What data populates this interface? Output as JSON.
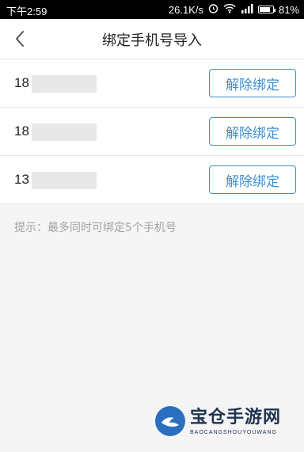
{
  "status_bar": {
    "time": "下午2:59",
    "speed": "26.1K/s",
    "battery_text": "81%",
    "battery_level": 0.81,
    "icons": [
      "alarm-icon",
      "wifi-icon",
      "signal-icon",
      "battery-icon"
    ]
  },
  "header": {
    "title": "绑定手机号导入",
    "back_icon": "chevron-left-icon"
  },
  "bound_numbers": [
    {
      "visible_prefix": "18",
      "unbind_label": "解除绑定"
    },
    {
      "visible_prefix": "18",
      "unbind_label": "解除绑定"
    },
    {
      "visible_prefix": "13",
      "unbind_label": "解除绑定"
    }
  ],
  "hint": "提示：最多同时可绑定5个手机号",
  "watermark": {
    "name": "宝仓手游网",
    "sub": "BAOCANGSHOUYOUWANG"
  },
  "colors": {
    "accent": "#3d8fd1",
    "hint_text": "#a3a3a3",
    "status_bar_bg": "#000000"
  }
}
